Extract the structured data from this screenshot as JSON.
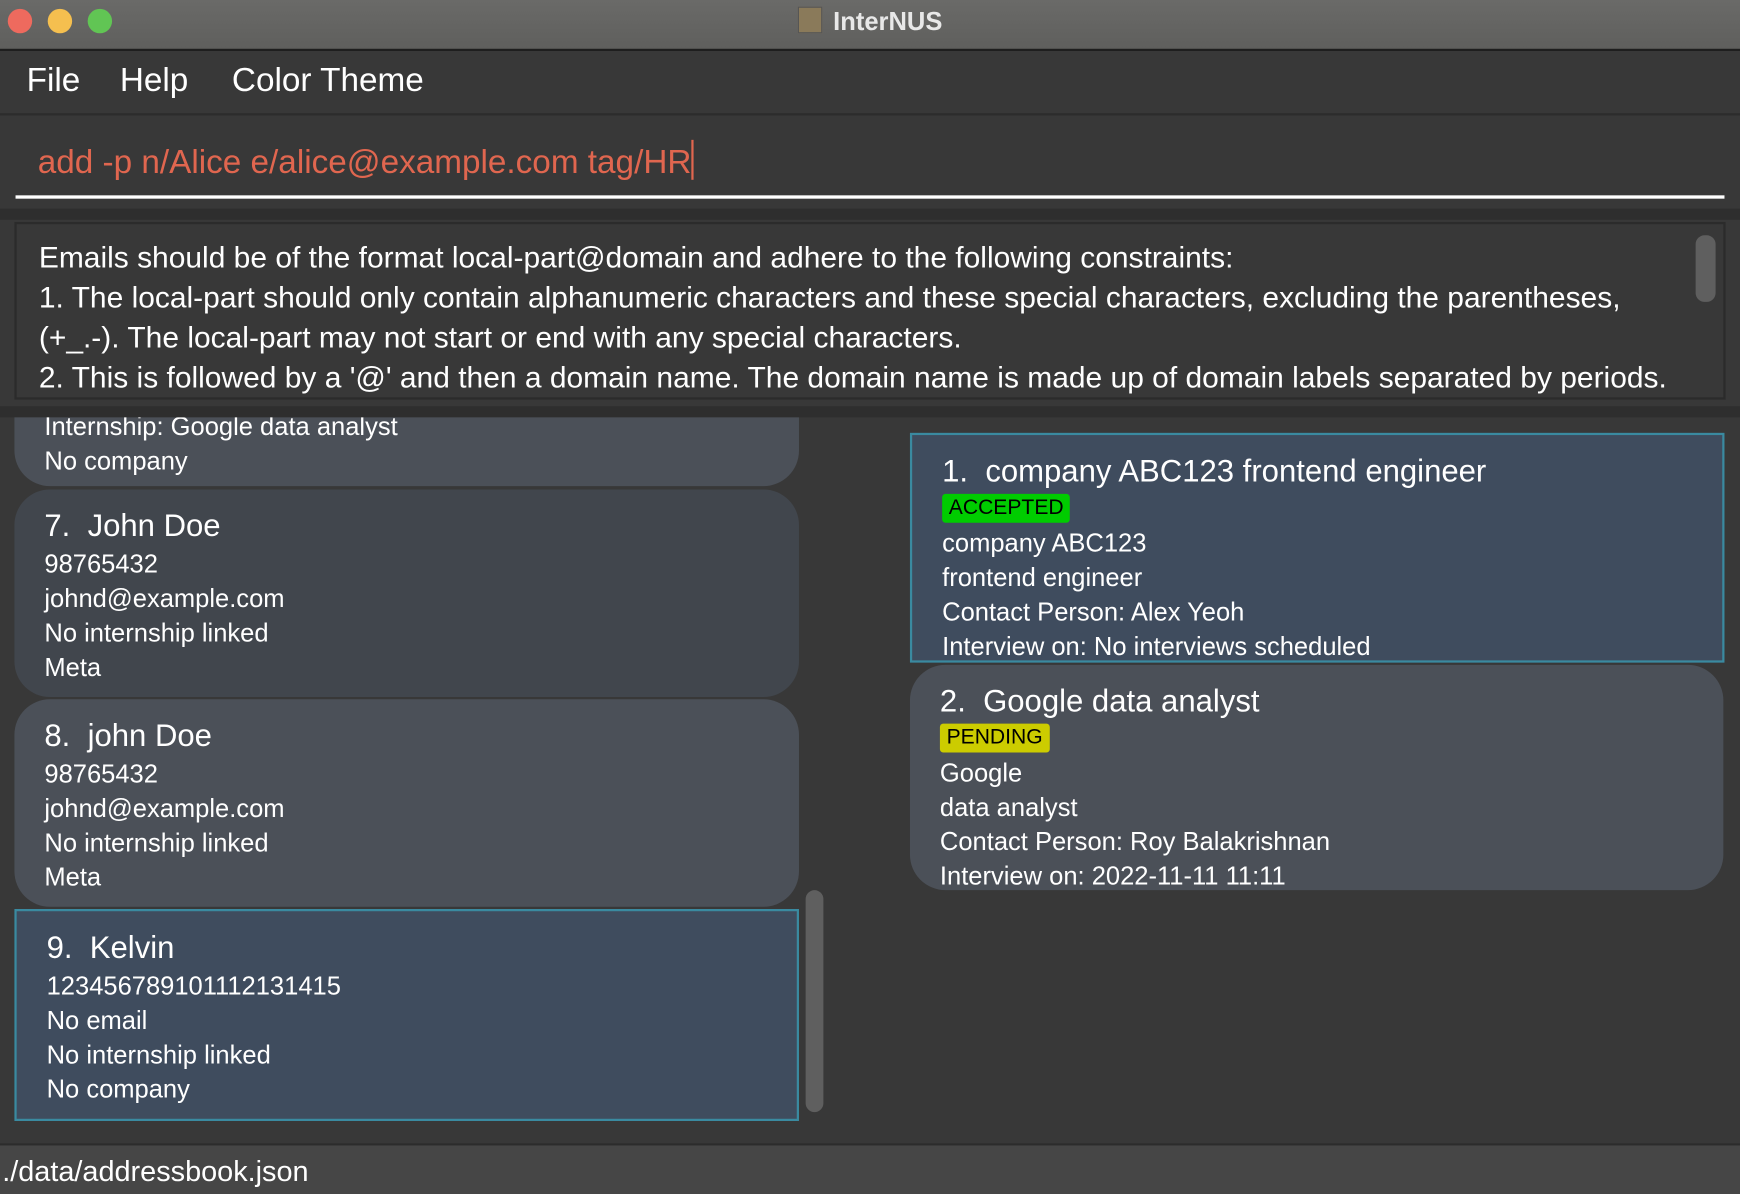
{
  "window": {
    "title": "InterNUS",
    "controls": {
      "close": "#ee6a5e",
      "minimize": "#f5bf4f",
      "maximize": "#61c554"
    }
  },
  "menu": [
    {
      "label": "File"
    },
    {
      "label": "Help"
    },
    {
      "label": "Color Theme"
    }
  ],
  "command": {
    "value": "add -p n/Alice e/alice@example.com tag/HR",
    "color": "#e0664f"
  },
  "result": {
    "lines": [
      "Emails should be of the format local-part@domain and adhere to the following constraints:",
      "1. The local-part should only contain alphanumeric characters and these special characters, excluding the parentheses,",
      "(+_.-). The local-part may not start or end with any special characters.",
      "2. This is followed by a '@' and then a domain name. The domain name is made up of domain labels separated by periods."
    ]
  },
  "persons": [
    {
      "lines": [
        "Internship: Google data analyst",
        "No company"
      ]
    },
    {
      "index": "7.",
      "name": "John Doe",
      "lines": [
        "98765432",
        "johnd@example.com",
        "No internship linked",
        "Meta"
      ]
    },
    {
      "index": "8.",
      "name": "john Doe",
      "lines": [
        "98765432",
        "johnd@example.com",
        "No internship linked",
        "Meta"
      ]
    },
    {
      "index": "9.",
      "name": "Kelvin",
      "lines": [
        "123456789101112131415",
        "No email",
        "No internship linked",
        "No company"
      ],
      "selected": true
    }
  ],
  "internships": [
    {
      "index": "1.",
      "title": "company ABC123 frontend engineer",
      "status": "ACCEPTED",
      "status_color": "#00cc00",
      "lines": [
        "company ABC123",
        "frontend engineer",
        "Contact Person: Alex Yeoh",
        "Interview on: No interviews scheduled"
      ],
      "selected": true
    },
    {
      "index": "2.",
      "title": "Google data analyst",
      "status": "PENDING",
      "status_color": "#cccc00",
      "lines": [
        "Google",
        "data analyst",
        "Contact Person: Roy Balakrishnan",
        "Interview on: 2022-11-11 11:11"
      ]
    }
  ],
  "status": {
    "path": "./data/addressbook.json"
  }
}
